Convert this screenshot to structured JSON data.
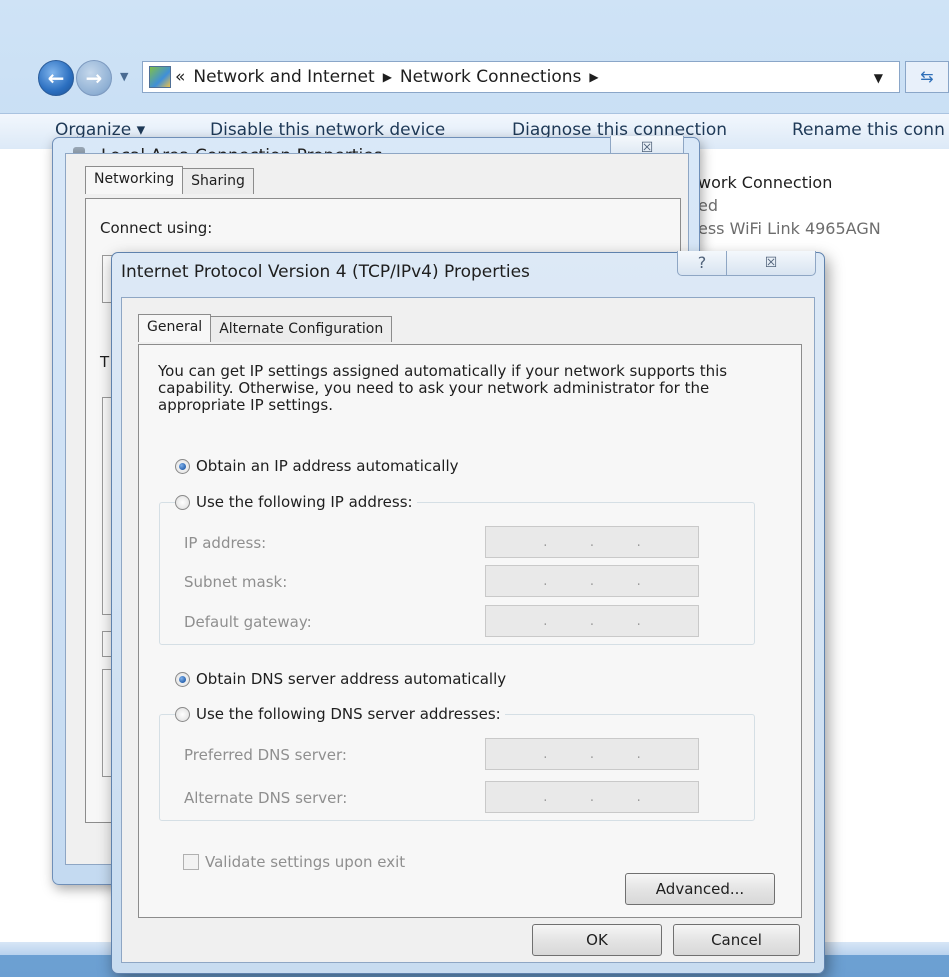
{
  "explorer": {
    "address": {
      "overflow": "«",
      "crumbs": [
        "Network and Internet",
        "Network Connections"
      ]
    },
    "toolbar": {
      "organize": "Organize ▾",
      "disable": "Disable this network device",
      "diagnose": "Diagnose this connection",
      "rename": "Rename this conn"
    },
    "connection": {
      "name": "work Connection",
      "status": "ed",
      "adapter": "ess WiFi Link 4965AGN"
    }
  },
  "lac_dialog": {
    "title": "Local Area Connection Properties",
    "tabs": [
      "Networking",
      "Sharing"
    ],
    "partial_labels": {
      "connect_using": "Connect using:",
      "this_connection": "T"
    }
  },
  "ipv4_dialog": {
    "title": "Internet Protocol Version 4 (TCP/IPv4) Properties",
    "help": "?",
    "close": "☒",
    "tabs": [
      "General",
      "Alternate Configuration"
    ],
    "intro": "You can get IP settings assigned automatically if your network supports this capability. Otherwise, you need to ask your network administrator for the appropriate IP settings.",
    "ip_auto": "Obtain an IP address automatically",
    "ip_manual": "Use the following IP address:",
    "ip_fields": {
      "ip_address": "IP address:",
      "subnet_mask": "Subnet mask:",
      "default_gateway": "Default gateway:"
    },
    "dns_auto": "Obtain DNS server address automatically",
    "dns_manual": "Use the following DNS server addresses:",
    "dns_fields": {
      "preferred": "Preferred DNS server:",
      "alternate": "Alternate DNS server:"
    },
    "ip_placeholder": ".",
    "validate": "Validate settings upon exit",
    "advanced": "Advanced...",
    "ok": "OK",
    "cancel": "Cancel",
    "state": {
      "ip_mode": "auto",
      "dns_mode": "auto",
      "validate_checked": false
    }
  }
}
